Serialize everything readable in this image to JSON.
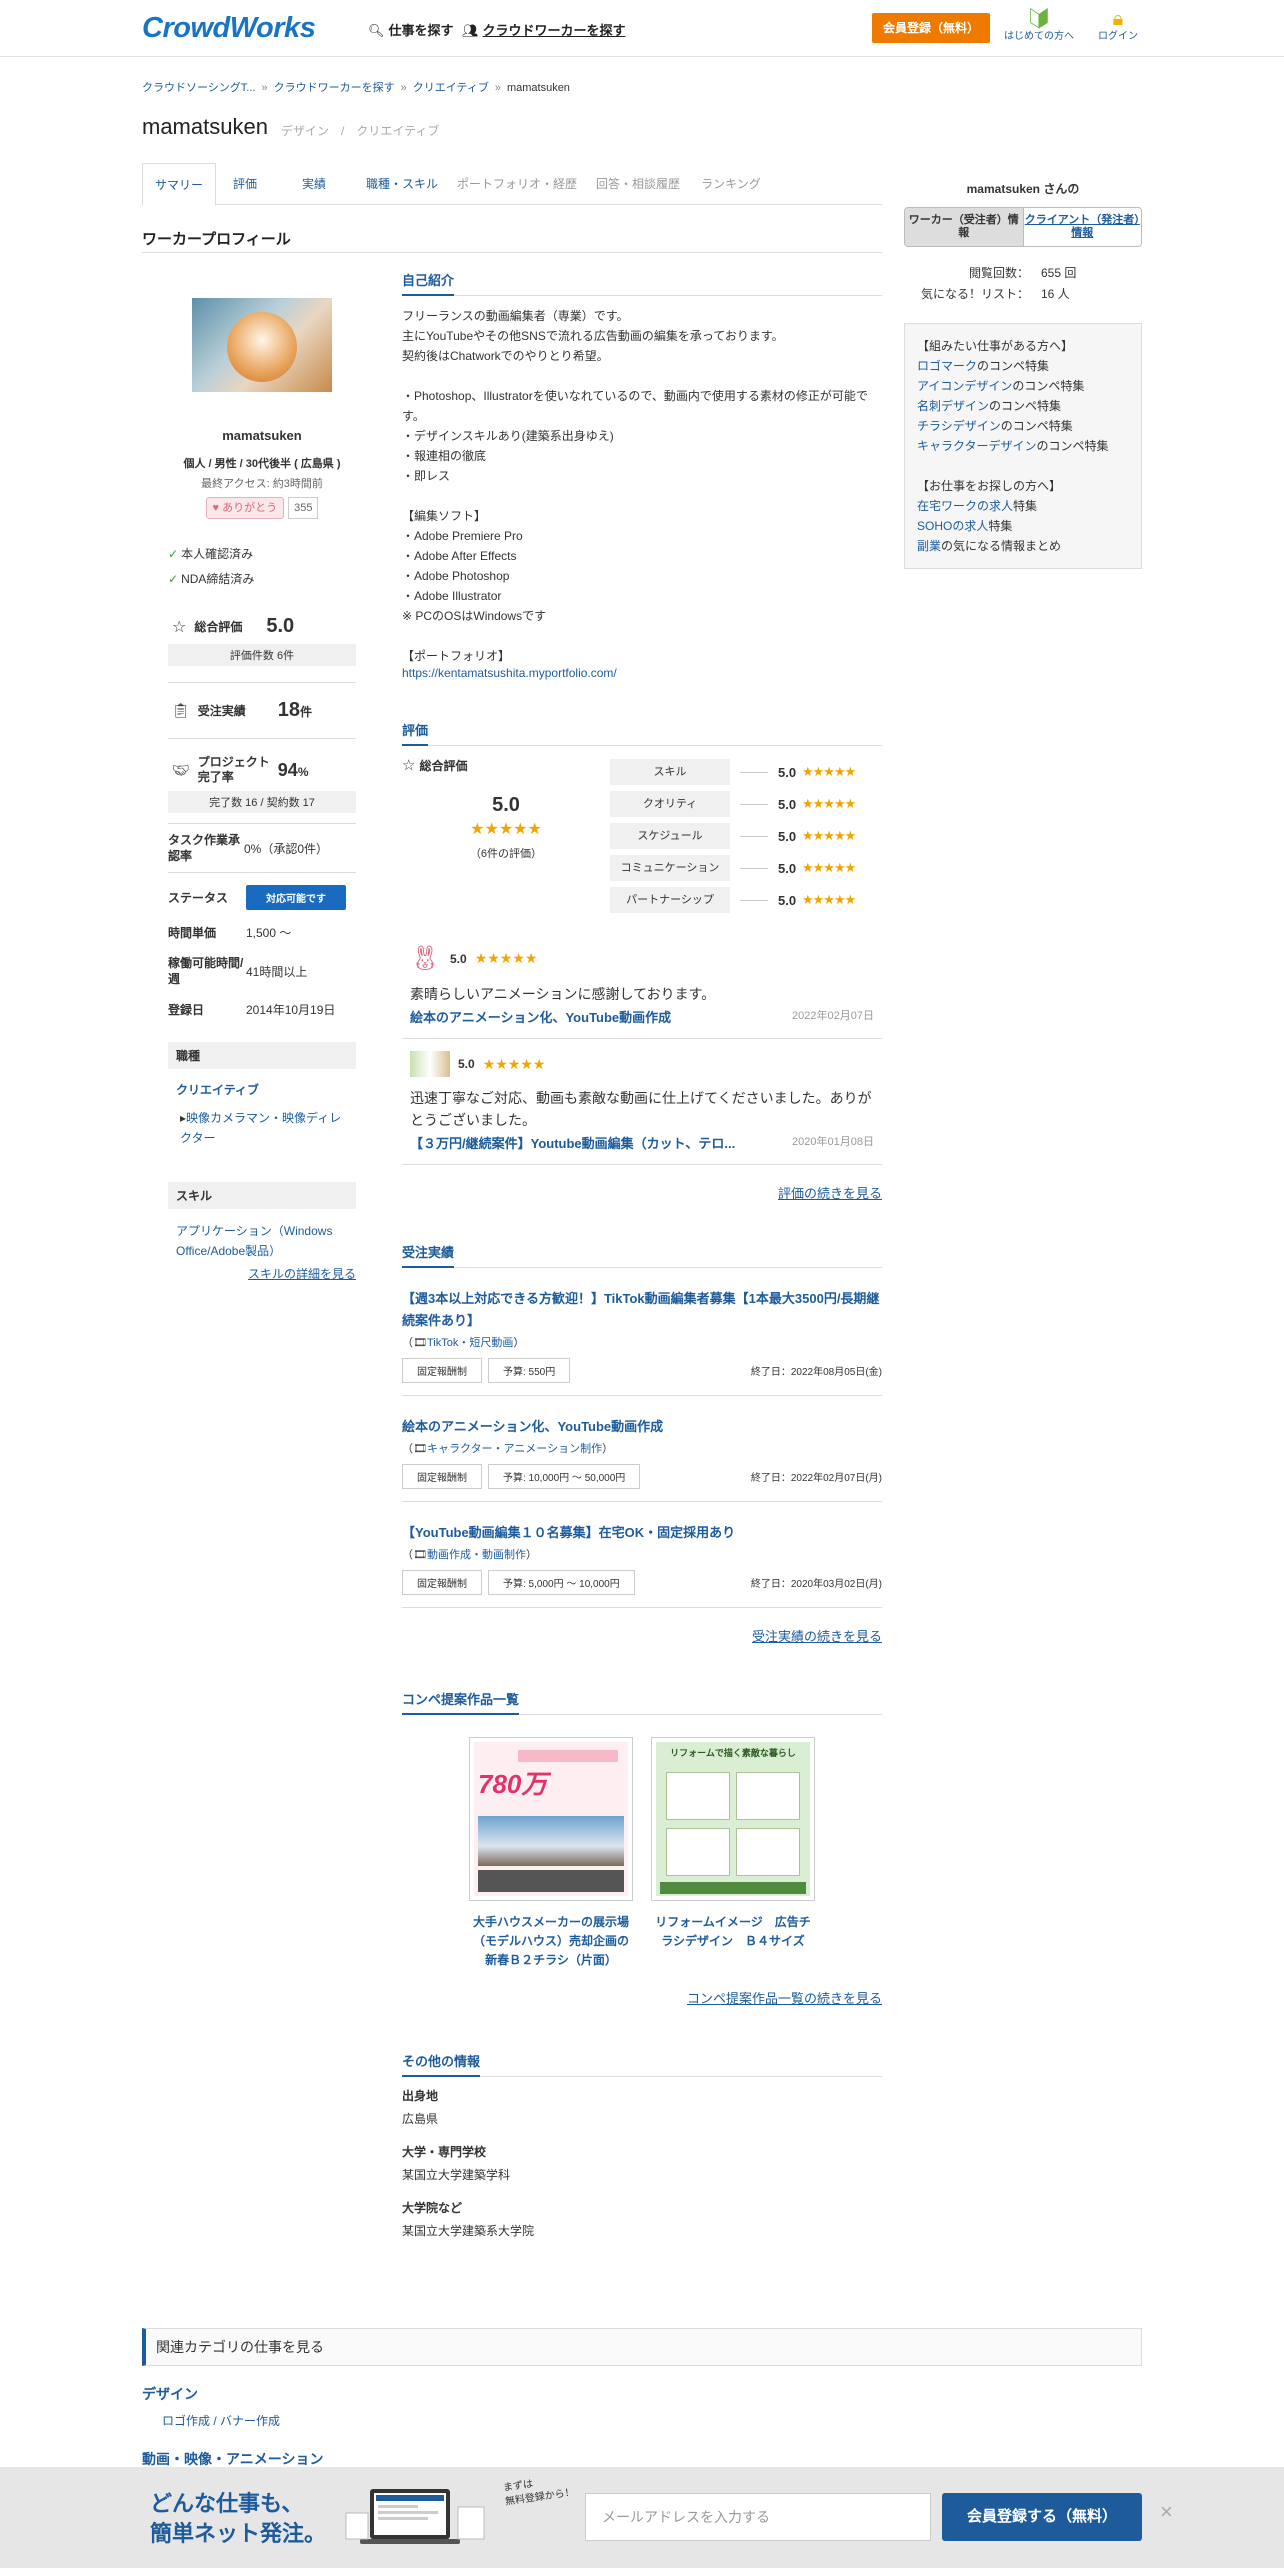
{
  "header": {
    "logo": "CrowdWorks",
    "find_jobs": "仕事を探す",
    "find_workers": "クラウドワーカーを探す",
    "register": "会員登録（無料）",
    "beginners": "はじめての方へ",
    "login": "ログイン"
  },
  "breadcrumb": [
    "クラウドソーシングT...",
    "クラウドワーカーを探す",
    "クリエイティブ",
    "mamatsuken"
  ],
  "page": {
    "title": "mamatsuken",
    "categories": "デザイン　/　クリエイティブ"
  },
  "tabs": [
    {
      "label": "サマリー",
      "state": "active"
    },
    {
      "label": "評価",
      "state": "link"
    },
    {
      "label": "実績",
      "state": "link"
    },
    {
      "label": "職種・スキル",
      "state": "link"
    },
    {
      "label": "ポートフォリオ・経歴",
      "state": "disabled"
    },
    {
      "label": "回答・相談履歴",
      "state": "disabled"
    },
    {
      "label": "ランキング",
      "state": "disabled"
    }
  ],
  "section_title": "ワーカープロフィール",
  "profile": {
    "username": "mamatsuken",
    "info": "個人 / 男性 / 30代後半 ( 広島県 )",
    "last_access": "最終アクセス: 約3時間前",
    "thanks_label": "ありがとう",
    "thanks_count": "355",
    "verify_id": "本人確認済み",
    "verify_nda": "NDA締結済み",
    "rating_label": "総合評価",
    "rating_value": "5.0",
    "rating_count": "評価件数 6件",
    "orders_label": "受注実績",
    "orders_value": "18",
    "orders_unit": "件",
    "completion_label": "プロジェクト完了率",
    "completion_value": "94",
    "completion_unit": "%",
    "completion_detail": "完了数 16 / 契約数 17",
    "task_label": "タスク作業承認率",
    "task_value": "0%（承認0件）",
    "status_label": "ステータス",
    "status_value": "対応可能です",
    "hourly_label": "時間単価",
    "hourly_value": "1,500 〜",
    "hours_label": "稼働可能時間/週",
    "hours_value": "41時間以上",
    "registered_label": "登録日",
    "registered_value": "2014年10月19日",
    "job_type_heading": "職種",
    "job_type_cat": "クリエイティブ",
    "job_type_item": "映像カメラマン・映像ディレクター",
    "skills_heading": "スキル",
    "skills_item": "アプリケーション（Windows Office/Adobe製品）",
    "skills_more": "スキルの詳細を見る"
  },
  "intro": {
    "heading": "自己紹介",
    "text": "フリーランスの動画編集者（専業）です。\n主にYouTubeやその他SNSで流れる広告動画の編集を承っております。\n契約後はChatworkでのやりとり希望。\n\n・Photoshop、Illustratorを使いなれているので、動画内で使用する素材の修正が可能です。\n・デザインスキルあり(建築系出身ゆえ)\n・報連相の徹底\n・即レス\n\n【編集ソフト】\n・Adobe Premiere Pro\n・Adobe After Effects\n・Adobe Photoshop\n・Adobe Illustrator\n※ PCのOSはWindowsです\n\n【ポートフォリオ】",
    "portfolio_url": "https://kentamatsushita.myportfolio.com/"
  },
  "evaluation": {
    "heading": "評価",
    "overall_label": "総合評価",
    "overall_value": "5.0",
    "overall_count": "（6件の評価）",
    "stars": "★★★★★",
    "items": [
      {
        "label": "スキル",
        "value": "5.0"
      },
      {
        "label": "クオリティ",
        "value": "5.0"
      },
      {
        "label": "スケジュール",
        "value": "5.0"
      },
      {
        "label": "コミュニケーション",
        "value": "5.0"
      },
      {
        "label": "パートナーシップ",
        "value": "5.0"
      }
    ],
    "reviews": [
      {
        "score": "5.0",
        "text": "素晴らしいアニメーションに感謝しております。",
        "job": "絵本のアニメーション化、YouTube動画作成",
        "date": "2022年02月07日"
      },
      {
        "score": "5.0",
        "text": "迅速丁寧なご対応、動画も素敵な動画に仕上げてくださいました。ありがとうございました。",
        "job": "【３万円/継続案件】Youtube動画編集（カット、テロ...",
        "date": "2020年01月08日"
      }
    ],
    "more": "評価の続きを見る"
  },
  "orders": {
    "heading": "受注実績",
    "jobs": [
      {
        "title": "【週3本以上対応できる方歓迎！】TikTok動画編集者募集【1本最大3500円/長期継続案件あり】",
        "category": "TikTok・短尺動画",
        "type": "固定報酬制",
        "budget": "予算: 550円",
        "end": "終了日：2022年08月05日(金)"
      },
      {
        "title": "絵本のアニメーション化、YouTube動画作成",
        "category": "キャラクター・アニメーション制作",
        "type": "固定報酬制",
        "budget": "予算: 10,000円 〜 50,000円",
        "end": "終了日：2022年02月07日(月)"
      },
      {
        "title": "【YouTube動画編集１０名募集】在宅OK・固定採用あり",
        "category": "動画作成・動画制作",
        "type": "固定報酬制",
        "budget": "予算: 5,000円 〜 10,000円",
        "end": "終了日：2020年03月02日(月)"
      }
    ],
    "more": "受注実績の続きを見る"
  },
  "konpe": {
    "heading": "コンペ提案作品一覧",
    "items": [
      {
        "caption": "大手ハウスメーカーの展示場（モデルハウス）売却企画の新春Ｂ２チラシ（片面）",
        "img_text": "780万"
      },
      {
        "caption": "リフォームイメージ　広告チラシデザイン　Ｂ４サイズ",
        "img_text": "リフォームで描く素敵な暮らし"
      }
    ],
    "more": "コンペ提案作品一覧の続きを見る"
  },
  "other": {
    "heading": "その他の情報",
    "birthplace_label": "出身地",
    "birthplace_value": "広島県",
    "univ_label": "大学・専門学校",
    "univ_value": "某国立大学建築学科",
    "grad_label": "大学院など",
    "grad_value": "某国立大学建築系大学院"
  },
  "sidebar": {
    "name": "mamatsuken さんの",
    "toggle_worker": "ワーカー（受注者）情報",
    "toggle_client": "クライアント（発注者）情報",
    "views_label": "閲覧回数：",
    "views_value": "655 回",
    "fav_label": "気になる！リスト：",
    "fav_value": "16 人",
    "box_heading1": "【組みたい仕事がある方へ】",
    "box_links1": [
      {
        "link": "ロゴマーク",
        "rest": "のコンペ特集"
      },
      {
        "link": "アイコンデザイン",
        "rest": "のコンペ特集"
      },
      {
        "link": "名刺デザイン",
        "rest": "のコンペ特集"
      },
      {
        "link": "チラシデザイン",
        "rest": "のコンペ特集"
      },
      {
        "link": "キャラクターデザイン",
        "rest": "のコンペ特集"
      }
    ],
    "box_heading2": "【お仕事をお探しの方へ】",
    "box_links2": [
      {
        "link": "在宅ワークの求人",
        "rest": "特集"
      },
      {
        "link": "SOHOの求人",
        "rest": "特集"
      },
      {
        "link": "副業",
        "rest": "の気になる情報まとめ"
      }
    ]
  },
  "related": {
    "heading": "関連カテゴリの仕事を見る",
    "cat1": "デザイン",
    "item1": "ロゴ作成 / バナー作成",
    "cat2": "動画・映像・アニメーション"
  },
  "footer_bar": {
    "line1": "どんな仕事も、",
    "line2": "簡単ネット発注。",
    "tag_line1": "まずは",
    "tag_line2": "無料登録から！",
    "email_placeholder": "メールアドレスを入力する",
    "button": "会員登録する（無料）",
    "close": "×"
  },
  "colors": {
    "brand": "#1a74c4",
    "link": "#1d5b9b",
    "accent": "#ef7a00",
    "star": "#f0a500"
  }
}
